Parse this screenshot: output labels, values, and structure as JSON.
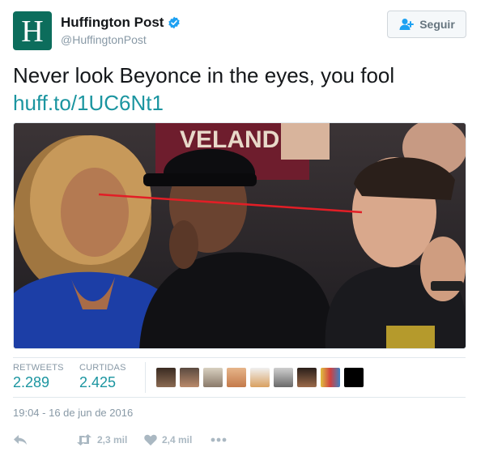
{
  "account": {
    "avatar_letter": "H",
    "avatar_color": "#0c6d5c",
    "name": "Huffington Post",
    "handle": "@HuffingtonPost",
    "verified_icon": "verified-badge-icon"
  },
  "follow_button": {
    "label": "Seguir",
    "icon": "add-person-icon"
  },
  "tweet": {
    "text": "Never look Beyonce in the eyes, you fool",
    "link": "huff.to/1UC6Nt1"
  },
  "photo": {
    "jersey_text": "VELAND"
  },
  "stats": {
    "retweets_label": "RETWEETS",
    "retweets_value": "2.289",
    "likes_label": "CURTIDAS",
    "likes_value": "2.425"
  },
  "favoriters": [
    {
      "name": "favoriter-avatar-1"
    },
    {
      "name": "favoriter-avatar-2"
    },
    {
      "name": "favoriter-avatar-3"
    },
    {
      "name": "favoriter-avatar-4"
    },
    {
      "name": "favoriter-avatar-5"
    },
    {
      "name": "favoriter-avatar-6"
    },
    {
      "name": "favoriter-avatar-7"
    },
    {
      "name": "favoriter-avatar-8"
    },
    {
      "name": "favoriter-avatar-9"
    }
  ],
  "timestamp": "19:04 - 16 de jun de 2016",
  "actions": {
    "reply_icon": "reply-icon",
    "retweet_icon": "retweet-icon",
    "retweet_count": "2,3 mil",
    "like_icon": "heart-icon",
    "like_count": "2,4 mil",
    "more_icon": "more-icon"
  },
  "colors": {
    "link": "#1b95a0",
    "muted": "#8899a6",
    "verified": "#1da1f2"
  }
}
